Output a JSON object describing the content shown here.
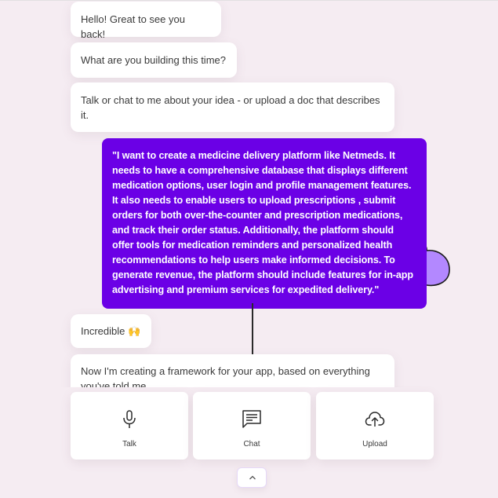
{
  "conversation": {
    "assistant_messages": [
      "Hello! Great to see you back!",
      "What are you building this time?",
      "Talk or chat to me about your idea - or upload a doc that describes it.",
      "Incredible 🙌",
      "Now I'm creating a framework for your app, based on everything you've told me."
    ],
    "user_message": "\"I want to create a medicine delivery platform like Netmeds. It needs to have a comprehensive database that displays different medication options, user login and profile management features. It also needs to enable users to upload prescriptions , submit orders for both over-the-counter and prescription medications, and track their order status. Additionally, the platform should offer tools for medication reminders and personalized health recommendations to help users make informed decisions. To generate revenue, the platform should include features for in-app advertising and premium services for expedited delivery.\""
  },
  "actions": {
    "talk": {
      "label": "Talk",
      "icon": "microphone-icon"
    },
    "chat": {
      "label": "Chat",
      "icon": "chat-bubble-icon"
    },
    "upload": {
      "label": "Upload",
      "icon": "cloud-upload-icon"
    }
  },
  "collapse": {
    "icon": "chevron-up-icon"
  },
  "colors": {
    "background": "#f5ecf2",
    "user_bubble": "#6b00e6",
    "cloud_fill": "#b388ff"
  }
}
